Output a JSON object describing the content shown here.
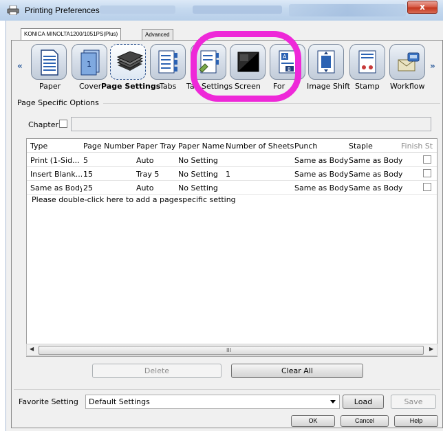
{
  "window": {
    "title": "Printing Preferences",
    "close_label": "x"
  },
  "tabs": [
    {
      "label": "KONICA MINOLTA1200/1051PS(Plus)"
    },
    {
      "label": "Advanced"
    }
  ],
  "toolbar": {
    "items": [
      {
        "label": "Paper",
        "icon": "paper-icon"
      },
      {
        "label": "Cover",
        "icon": "cover-icon"
      },
      {
        "label": "Page Settings",
        "icon": "page-settings-icon",
        "selected": true
      },
      {
        "label": "Tabs",
        "icon": "tabs-icon"
      },
      {
        "label": "Tab Settings",
        "icon": "tab-settings-icon"
      },
      {
        "label": "Screen",
        "icon": "screen-icon"
      },
      {
        "label": "Forms",
        "icon": "forms-icon"
      },
      {
        "label": "Image Shift",
        "icon": "image-shift-icon"
      },
      {
        "label": "Stamp",
        "icon": "stamp-icon"
      },
      {
        "label": "Workflow",
        "icon": "workflow-icon"
      }
    ],
    "tab_label_part_1": "Ta",
    "tab_label_part_2": "Settings",
    "forms_label_part_1": "For",
    "forms_label_part_2": "s",
    "highlight_color": "#ee28d8"
  },
  "page_specific": {
    "section_label": "Page Specific Options",
    "chapter_label": "Chapter",
    "chapter_checked": false,
    "chapter_value": ""
  },
  "grid": {
    "columns": [
      "Type",
      "Page Number",
      "Paper Tray",
      "Paper Name",
      "Number of Sheets",
      "Punch",
      "Staple",
      "Finish St"
    ],
    "rows": [
      {
        "type": "Print (1-Sid...",
        "page_number": "5",
        "paper_tray": "Auto",
        "paper_name": "No Setting",
        "sheets": "",
        "punch": "Same as Body",
        "staple": "Same as Body"
      },
      {
        "type": "Insert Blank...",
        "page_number": "15",
        "paper_tray": "Tray 5",
        "paper_name": "No Setting",
        "sheets": "1",
        "punch": "Same as Body",
        "staple": "Same as Body"
      },
      {
        "type": "Same as Body",
        "page_number": "25",
        "paper_tray": "Auto",
        "paper_name": "No Setting",
        "sheets": "",
        "punch": "Same as Body",
        "staple": "Same as Body"
      }
    ],
    "hint": "Please double-click here to add a pagespecific setting",
    "scroll_grip": "III"
  },
  "actions": {
    "delete_label": "Delete",
    "clear_all_label": "Clear All"
  },
  "favorite": {
    "label": "Favorite Setting",
    "value": "Default Settings",
    "load_label": "Load",
    "save_label": "Save"
  },
  "footer": {
    "ok_label": "OK",
    "cancel_label": "Cancel",
    "help_label": "Help"
  }
}
